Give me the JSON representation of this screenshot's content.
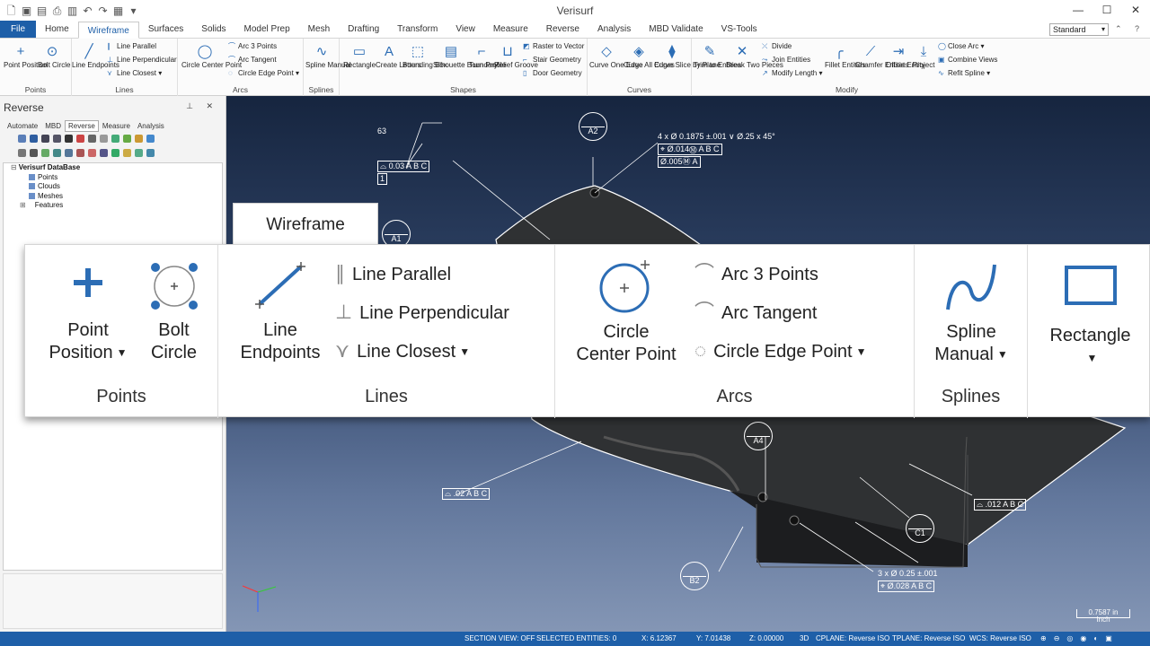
{
  "app": {
    "title": "Verisurf"
  },
  "menu": {
    "tabs": [
      "File",
      "Home",
      "Wireframe",
      "Surfaces",
      "Solids",
      "Model Prep",
      "Mesh",
      "Drafting",
      "Transform",
      "View",
      "Measure",
      "Reverse",
      "Analysis",
      "MBD Validate",
      "VS-Tools"
    ],
    "active": "Wireframe",
    "standard_select": "Standard"
  },
  "ribbon": {
    "points": {
      "label": "Points",
      "point_position": "Point Position",
      "bolt_circle": "Bolt Circle"
    },
    "lines": {
      "label": "Lines",
      "line_endpoints": "Line Endpoints",
      "line_parallel": "Line Parallel",
      "line_perpendicular": "Line Perpendicular",
      "line_closest": "Line Closest"
    },
    "arcs": {
      "label": "Arcs",
      "circle_center_point": "Circle Center Point",
      "arc_3_points": "Arc 3 Points",
      "arc_tangent": "Arc Tangent",
      "circle_edge_point": "Circle Edge Point"
    },
    "splines": {
      "label": "Splines",
      "spline_manual": "Spline Manual"
    },
    "shapes": {
      "label": "Shapes",
      "rectangle": "Rectangle",
      "create_letters": "Create Letters",
      "bounding_box": "Bounding Box",
      "silhouette_boundary": "Silhouette Boundary",
      "turn_profile": "Turn Profile",
      "relief_groove": "Relief Groove",
      "raster_to_vector": "Raster to Vector",
      "stair_geometry": "Stair Geometry",
      "door_geometry": "Door Geometry"
    },
    "curves": {
      "label": "Curves",
      "curve_one_edge": "Curve One Edge",
      "curve_all_edges": "Curve All Edges",
      "curve_slice": "Curve Slice by Plane"
    },
    "modify": {
      "label": "Modify",
      "trim_to_entities": "Trim to Entities",
      "break_two_pieces": "Break Two Pieces",
      "divide": "Divide",
      "join_entities": "Join Entities",
      "modify_length": "Modify Length",
      "fillet_entities": "Fillet Entities",
      "chamfer_entities": "Chamfer Entities",
      "offset_entity": "Offset Entity",
      "project": "Project",
      "close_arc": "Close Arc",
      "combine_views": "Combine Views",
      "refit_spline": "Refit Spline"
    }
  },
  "panel": {
    "title": "Reverse",
    "tabs": [
      "Automate",
      "MBD",
      "Reverse",
      "Measure",
      "Analysis"
    ],
    "active_tab": "Reverse",
    "tree": {
      "root": "Verisurf DataBase",
      "items": [
        "Points",
        "Clouds",
        "Meshes"
      ],
      "features": "Features"
    }
  },
  "zoom": {
    "tab": "Wireframe",
    "points_label": "Points",
    "point_position": [
      "Point",
      "Position"
    ],
    "bolt_circle": [
      "Bolt",
      "Circle"
    ],
    "lines_label": "Lines",
    "line_endpoints": [
      "Line",
      "Endpoints"
    ],
    "line_parallel": "Line Parallel",
    "line_perpendicular": "Line Perpendicular",
    "line_closest": "Line Closest",
    "arcs_label": "Arcs",
    "circle_center_point": [
      "Circle",
      "Center Point"
    ],
    "arc_3_points": "Arc 3 Points",
    "arc_tangent": "Arc Tangent",
    "circle_edge_point": "Circle Edge Point",
    "splines_label": "Splines",
    "spline_manual": [
      "Spline",
      "Manual"
    ],
    "rectangle": "Rectangle"
  },
  "viewport": {
    "balloons": [
      "A2",
      "A1",
      "A4",
      "C1",
      "B2"
    ],
    "annotations": {
      "num63": "63",
      "fcf1": "⌓ 0.03 A B C",
      "datum1": "1",
      "hole_spec": "4 x Ø 0.1875 ±.001  ∨ Ø.25 x 45°",
      "fcf_pos1": "⌖ Ø.014Ⓜ A B C",
      "fcf_pos2": "Ø.005Ⓜ A",
      "fcf_left": "⌓ .02 A B C",
      "fcf_right": "⌓ .012 A B C",
      "hole_spec2": "3 x Ø 0.25 ±.001",
      "fcf_pos3": "⌖ Ø.028 A B C"
    },
    "scale": {
      "value": "0.7587 in",
      "unit": "Inch"
    }
  },
  "status": {
    "section_view": "SECTION VIEW: OFF",
    "selected": "SELECTED ENTITIES: 0",
    "x": "X:   6.12367",
    "y": "Y:   7.01438",
    "z": "Z:   0.00000",
    "mode": "3D",
    "cplane": "CPLANE: Reverse ISO",
    "tplane": "TPLANE: Reverse ISO",
    "wcs": "WCS: Reverse ISO"
  },
  "colors": {
    "accent": "#1e5fa8",
    "icon": "#2c6db5"
  }
}
